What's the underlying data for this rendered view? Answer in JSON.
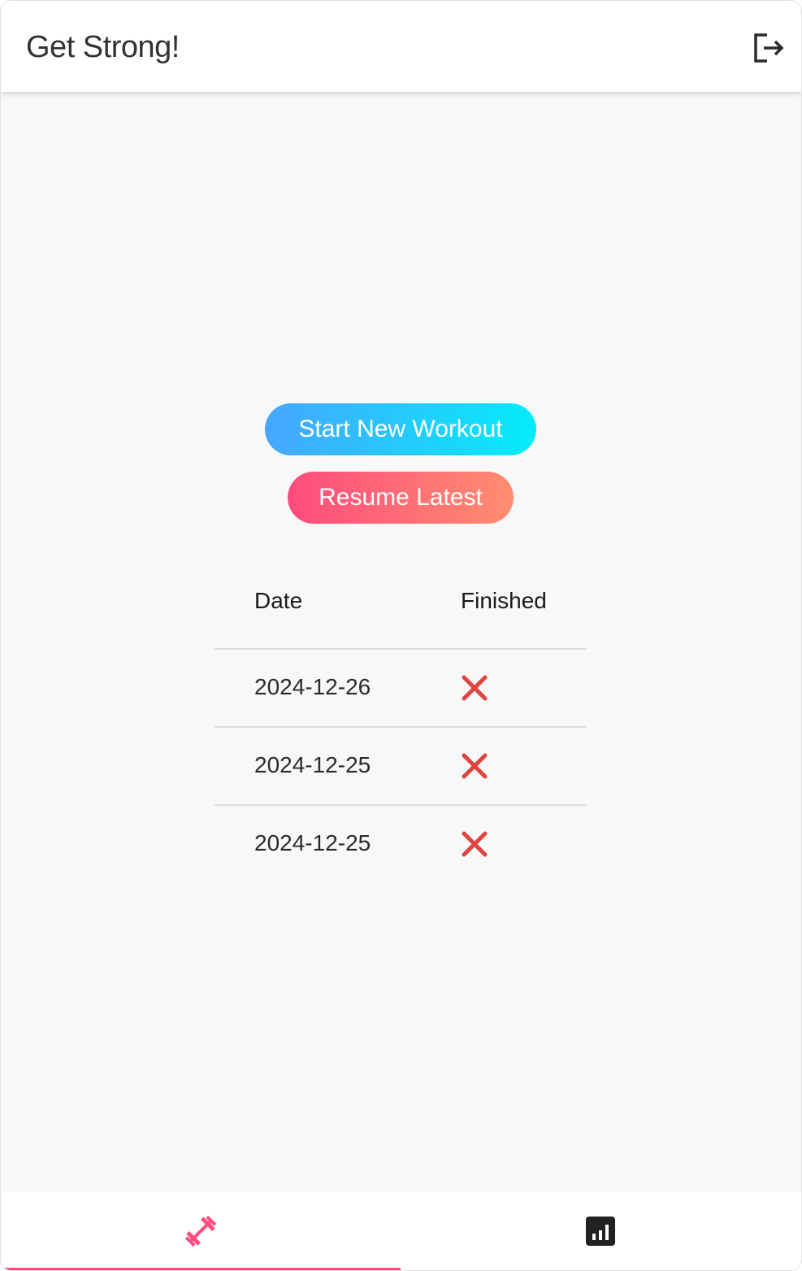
{
  "app": {
    "title": "Get Strong!"
  },
  "header": {
    "logout_icon": "logout-icon"
  },
  "actions": {
    "start_label": "Start New Workout",
    "resume_label": "Resume Latest"
  },
  "workouts_table": {
    "headers": {
      "date": "Date",
      "finished": "Finished"
    },
    "rows": [
      {
        "date": "2024-12-26",
        "finished": false
      },
      {
        "date": "2024-12-25",
        "finished": false
      },
      {
        "date": "2024-12-25",
        "finished": false
      }
    ]
  },
  "bottom_nav": {
    "tabs": [
      {
        "icon": "dumbbell-icon",
        "active": true
      },
      {
        "icon": "bar-chart-icon",
        "active": false
      }
    ]
  },
  "colors": {
    "accent": "#ff4b7d",
    "start_gradient": [
      "#47a6ff",
      "#04ecfb"
    ],
    "resume_gradient": [
      "#ff4b7d",
      "#ff8d70"
    ],
    "not_finished": "#e0443e"
  }
}
